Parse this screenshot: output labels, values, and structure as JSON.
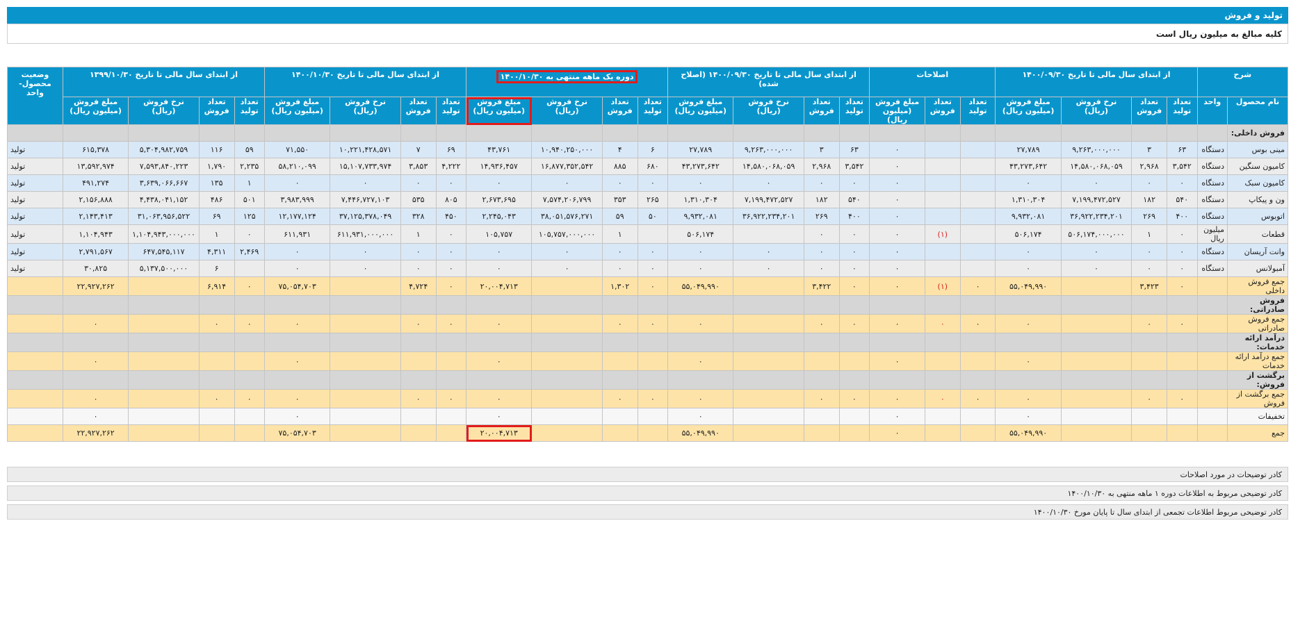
{
  "header": {
    "title": "تولید و فروش",
    "note": "کلیه مبالغ به میلیون ریال است"
  },
  "columns": {
    "desc": "شرح",
    "period1": "از ابتدای سال مالی تا تاریخ ۱۴۰۰/۰۹/۳۰",
    "corrections": "اصلاحات",
    "period2": "از ابتدای سال مالی تا تاریخ ۱۴۰۰/۰۹/۳۰ (اصلاح شده)",
    "month": "دوره یک ماهه منتهی به ۱۴۰۰/۱۰/۳۰",
    "ytd": "از ابتدای سال مالی تا تاریخ ۱۴۰۰/۱۰/۳۰",
    "prev": "از ابتدای سال مالی تا تاریخ ۱۳۹۹/۱۰/۳۰",
    "status": "وضعیت محصول- واحد",
    "product": "نام محصول",
    "unit": "واحد",
    "prod_qty": "تعداد تولید",
    "sale_qty": "تعداد فروش",
    "rate": "نرخ فروش (ریال)",
    "amount": "مبلغ فروش (میلیون ریال)"
  },
  "rows": [
    {
      "type": "sec",
      "label": "فروش داخلی:"
    },
    {
      "type": "blue",
      "label": "مینی بوس",
      "unit": "دستگاه",
      "p1": [
        "۶۳",
        "۳",
        "۹,۲۶۳,۰۰۰,۰۰۰",
        "۲۷,۷۸۹"
      ],
      "c": [
        "",
        "",
        "۰"
      ],
      "p2": [
        "۶۳",
        "۳",
        "۹,۲۶۳,۰۰۰,۰۰۰",
        "۲۷,۷۸۹"
      ],
      "m": [
        "۶",
        "۴",
        "۱۰,۹۴۰,۲۵۰,۰۰۰",
        "۴۳,۷۶۱"
      ],
      "y": [
        "۶۹",
        "۷",
        "۱۰,۲۲۱,۴۲۸,۵۷۱",
        "۷۱,۵۵۰"
      ],
      "pv": [
        "۵۹",
        "۱۱۶",
        "۵,۳۰۴,۹۸۲,۷۵۹",
        "۶۱۵,۳۷۸"
      ],
      "st": "تولید"
    },
    {
      "type": "gray",
      "label": "کامیون سنگین",
      "unit": "دستگاه",
      "p1": [
        "۳,۵۴۲",
        "۲,۹۶۸",
        "۱۴,۵۸۰,۰۶۸,۰۵۹",
        "۴۳,۲۷۳,۶۴۲"
      ],
      "c": [
        "",
        "",
        "۰"
      ],
      "p2": [
        "۳,۵۴۲",
        "۲,۹۶۸",
        "۱۴,۵۸۰,۰۶۸,۰۵۹",
        "۴۳,۲۷۳,۶۴۲"
      ],
      "m": [
        "۶۸۰",
        "۸۸۵",
        "۱۶,۸۷۷,۳۵۲,۵۴۲",
        "۱۴,۹۳۶,۴۵۷"
      ],
      "y": [
        "۴,۲۲۲",
        "۳,۸۵۳",
        "۱۵,۱۰۷,۷۳۳,۹۷۴",
        "۵۸,۲۱۰,۰۹۹"
      ],
      "pv": [
        "۲,۲۳۵",
        "۱,۷۹۰",
        "۷,۵۹۳,۸۴۰,۲۲۳",
        "۱۳,۵۹۲,۹۷۴"
      ],
      "st": "تولید"
    },
    {
      "type": "blue",
      "label": "کامیون سبک",
      "unit": "دستگاه",
      "p1": [
        "۰",
        "۰",
        "۰",
        "۰"
      ],
      "c": [
        "",
        "",
        "۰"
      ],
      "p2": [
        "۰",
        "۰",
        "۰",
        "۰"
      ],
      "m": [
        "۰",
        "۰",
        "۰",
        "۰"
      ],
      "y": [
        "۰",
        "۰",
        "۰",
        "۰"
      ],
      "pv": [
        "۱",
        "۱۳۵",
        "۳,۶۳۹,۰۶۶,۶۶۷",
        "۴۹۱,۲۷۴"
      ],
      "st": "تولید"
    },
    {
      "type": "gray",
      "label": "ون و پیکاپ",
      "unit": "دستگاه",
      "p1": [
        "۵۴۰",
        "۱۸۲",
        "۷,۱۹۹,۴۷۲,۵۲۷",
        "۱,۳۱۰,۳۰۴"
      ],
      "c": [
        "",
        "",
        "۰"
      ],
      "p2": [
        "۵۴۰",
        "۱۸۲",
        "۷,۱۹۹,۴۷۲,۵۲۷",
        "۱,۳۱۰,۳۰۴"
      ],
      "m": [
        "۲۶۵",
        "۳۵۳",
        "۷,۵۷۴,۲۰۶,۷۹۹",
        "۲,۶۷۳,۶۹۵"
      ],
      "y": [
        "۸۰۵",
        "۵۳۵",
        "۷,۴۴۶,۷۲۷,۱۰۳",
        "۳,۹۸۳,۹۹۹"
      ],
      "pv": [
        "۵۰۱",
        "۴۸۶",
        "۴,۴۳۸,۰۴۱,۱۵۲",
        "۲,۱۵۶,۸۸۸"
      ],
      "st": "تولید"
    },
    {
      "type": "blue",
      "label": "اتوبوس",
      "unit": "دستگاه",
      "p1": [
        "۴۰۰",
        "۲۶۹",
        "۳۶,۹۲۲,۲۳۴,۲۰۱",
        "۹,۹۳۲,۰۸۱"
      ],
      "c": [
        "",
        "",
        "۰"
      ],
      "p2": [
        "۴۰۰",
        "۲۶۹",
        "۳۶,۹۲۲,۲۳۴,۲۰۱",
        "۹,۹۳۲,۰۸۱"
      ],
      "m": [
        "۵۰",
        "۵۹",
        "۳۸,۰۵۱,۵۷۶,۲۷۱",
        "۲,۲۴۵,۰۴۳"
      ],
      "y": [
        "۴۵۰",
        "۳۲۸",
        "۳۷,۱۲۵,۳۷۸,۰۴۹",
        "۱۲,۱۷۷,۱۲۴"
      ],
      "pv": [
        "۱۲۵",
        "۶۹",
        "۳۱,۰۶۳,۹۵۶,۵۲۲",
        "۲,۱۴۳,۴۱۳"
      ],
      "st": "تولید"
    },
    {
      "type": "gray",
      "label": "قطعات",
      "unit": "میلیون ریال",
      "p1": [
        "۰",
        "۱",
        "۵۰۶,۱۷۴,۰۰۰,۰۰۰",
        "۵۰۶,۱۷۴"
      ],
      "c": [
        "",
        "(۱)",
        "۰"
      ],
      "p2": [
        "۰",
        "۰",
        "",
        "۵۰۶,۱۷۴"
      ],
      "m": [
        "",
        "۱",
        "۱۰۵,۷۵۷,۰۰۰,۰۰۰",
        "۱۰۵,۷۵۷"
      ],
      "y": [
        "۰",
        "۱",
        "۶۱۱,۹۳۱,۰۰۰,۰۰۰",
        "۶۱۱,۹۳۱"
      ],
      "pv": [
        "۰",
        "۱",
        "۱,۱۰۴,۹۴۳,۰۰۰,۰۰۰",
        "۱,۱۰۴,۹۴۳"
      ],
      "st": "تولید"
    },
    {
      "type": "blue",
      "label": "وانت آریسان",
      "unit": "دستگاه",
      "p1": [
        "۰",
        "۰",
        "۰",
        "۰"
      ],
      "c": [
        "",
        "",
        "۰"
      ],
      "p2": [
        "۰",
        "۰",
        "۰",
        "۰"
      ],
      "m": [
        "۰",
        "۰",
        "۰",
        "۰"
      ],
      "y": [
        "۰",
        "۰",
        "۰",
        "۰"
      ],
      "pv": [
        "۲,۴۶۹",
        "۴,۳۱۱",
        "۶۴۷,۵۴۵,۱۱۷",
        "۲,۷۹۱,۵۶۷"
      ],
      "st": "تولید"
    },
    {
      "type": "gray",
      "label": "آمبولانس",
      "unit": "دستگاه",
      "p1": [
        "۰",
        "۰",
        "۰",
        "۰"
      ],
      "c": [
        "",
        "",
        "۰"
      ],
      "p2": [
        "۰",
        "۰",
        "۰",
        "۰"
      ],
      "m": [
        "۰",
        "۰",
        "۰",
        "۰"
      ],
      "y": [
        "۰",
        "۰",
        "۰",
        "۰"
      ],
      "pv": [
        "",
        "۶",
        "۵,۱۳۷,۵۰۰,۰۰۰",
        "۳۰,۸۲۵"
      ],
      "st": "تولید"
    },
    {
      "type": "yellow",
      "label": "جمع فروش داخلی",
      "unit": "",
      "p1": [
        "۰",
        "۳,۴۲۳",
        "",
        "۵۵,۰۴۹,۹۹۰"
      ],
      "c": [
        "۰",
        "(۱)",
        "۰"
      ],
      "p2": [
        "۰",
        "۳,۴۲۲",
        "",
        "۵۵,۰۴۹,۹۹۰"
      ],
      "m": [
        "۰",
        "۱,۳۰۲",
        "",
        "۲۰,۰۰۴,۷۱۳"
      ],
      "y": [
        "۰",
        "۴,۷۲۴",
        "",
        "۷۵,۰۵۴,۷۰۳"
      ],
      "pv": [
        "۰",
        "۶,۹۱۴",
        "",
        "۲۲,۹۲۷,۲۶۲"
      ],
      "st": ""
    },
    {
      "type": "sec",
      "label": "فروش صادراتی:"
    },
    {
      "type": "yellow",
      "label": "جمع فروش صادراتی",
      "unit": "",
      "p1": [
        "۰",
        "۰",
        "",
        "۰"
      ],
      "c": [
        "۰",
        "۰",
        "۰"
      ],
      "p2": [
        "۰",
        "۰",
        "",
        "۰"
      ],
      "m": [
        "۰",
        "۰",
        "",
        "۰"
      ],
      "y": [
        "۰",
        "۰",
        "",
        "۰"
      ],
      "pv": [
        "۰",
        "۰",
        "",
        "۰"
      ],
      "st": ""
    },
    {
      "type": "sec",
      "label": "درآمد ارائه خدمات:"
    },
    {
      "type": "yellow",
      "label": "جمع درآمد ارائه خدمات",
      "unit": "",
      "p1": [
        "",
        "",
        "",
        "۰"
      ],
      "c": [
        "",
        "",
        "۰"
      ],
      "p2": [
        "",
        "",
        "",
        "۰"
      ],
      "m": [
        "",
        "",
        "",
        "۰"
      ],
      "y": [
        "",
        "",
        "",
        "۰"
      ],
      "pv": [
        "",
        "",
        "",
        "۰"
      ],
      "st": ""
    },
    {
      "type": "sec",
      "label": "برگشت از فروش:"
    },
    {
      "type": "yellow",
      "label": "جمع برگشت از فروش",
      "unit": "",
      "p1": [
        "۰",
        "۰",
        "",
        "۰"
      ],
      "c": [
        "۰",
        "۰",
        "۰"
      ],
      "p2": [
        "۰",
        "۰",
        "",
        "۰"
      ],
      "m": [
        "۰",
        "۰",
        "",
        "۰"
      ],
      "y": [
        "۰",
        "۰",
        "",
        "۰"
      ],
      "pv": [
        "۰",
        "۰",
        "",
        "۰"
      ],
      "st": ""
    },
    {
      "type": "white",
      "label": "تخفیفات",
      "unit": "",
      "p1": [
        "",
        "",
        "",
        "۰"
      ],
      "c": [
        "",
        "",
        "۰"
      ],
      "p2": [
        "",
        "",
        "",
        "۰"
      ],
      "m": [
        "",
        "",
        "",
        "۰"
      ],
      "y": [
        "",
        "",
        "",
        "۰"
      ],
      "pv": [
        "",
        "",
        "",
        "۰"
      ],
      "st": ""
    },
    {
      "type": "yellow",
      "label": "جمع",
      "unit": "",
      "p1": [
        "",
        "",
        "",
        "۵۵,۰۴۹,۹۹۰"
      ],
      "c": [
        "",
        "",
        "۰"
      ],
      "p2": [
        "",
        "",
        "",
        "۵۵,۰۴۹,۹۹۰"
      ],
      "m": [
        "",
        "",
        "",
        "۲۰,۰۰۴,۷۱۳"
      ],
      "y": [
        "",
        "",
        "",
        "۷۵,۰۵۴,۷۰۳"
      ],
      "pv": [
        "",
        "",
        "",
        "۲۲,۹۲۷,۲۶۲"
      ],
      "st": ""
    }
  ],
  "footer": [
    "کادر توضیحات در مورد اصلاحات",
    "کادر توضیحی مربوط به اطلاعات دوره ۱ ماهه منتهی به ۱۴۰۰/۱۰/۳۰",
    "کادر توضیحی مربوط اطلاعات تجمعی از ابتدای سال تا پایان مورخ ۱۴۰۰/۱۰/۳۰"
  ]
}
